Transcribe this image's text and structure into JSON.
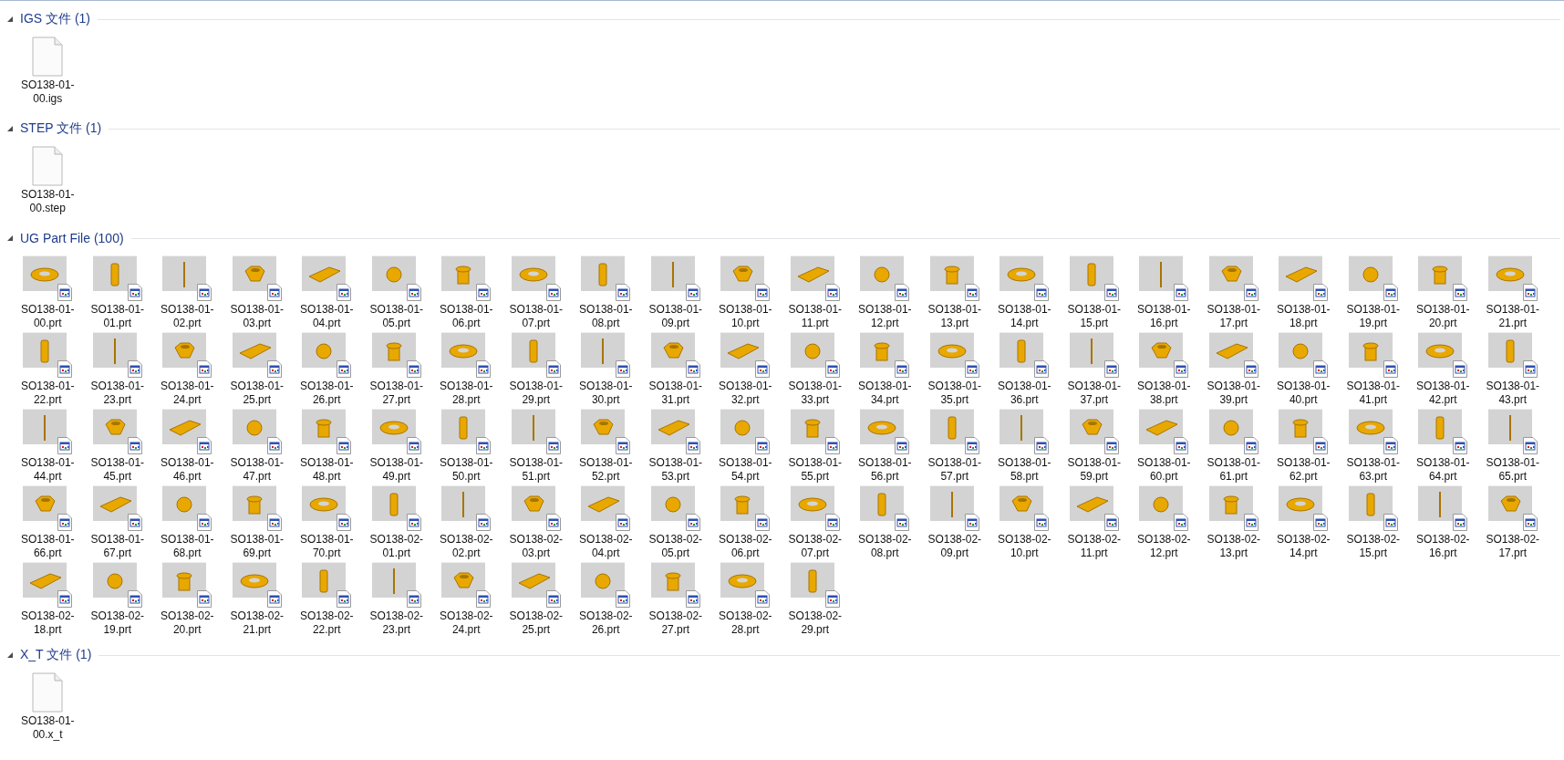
{
  "groups": [
    {
      "title": "IGS 文件 (1)",
      "expanded": true,
      "kind": "document",
      "files": [
        "SO138-01-00.igs"
      ]
    },
    {
      "title": "STEP 文件 (1)",
      "expanded": true,
      "kind": "document",
      "files": [
        "SO138-01-00.step"
      ]
    },
    {
      "title": "UG Part File (100)",
      "expanded": true,
      "kind": "part",
      "files": [
        "SO138-01-00.prt",
        "SO138-01-01.prt",
        "SO138-01-02.prt",
        "SO138-01-03.prt",
        "SO138-01-04.prt",
        "SO138-01-05.prt",
        "SO138-01-06.prt",
        "SO138-01-07.prt",
        "SO138-01-08.prt",
        "SO138-01-09.prt",
        "SO138-01-10.prt",
        "SO138-01-11.prt",
        "SO138-01-12.prt",
        "SO138-01-13.prt",
        "SO138-01-14.prt",
        "SO138-01-15.prt",
        "SO138-01-16.prt",
        "SO138-01-17.prt",
        "SO138-01-18.prt",
        "SO138-01-19.prt",
        "SO138-01-20.prt",
        "SO138-01-21.prt",
        "SO138-01-22.prt",
        "SO138-01-23.prt",
        "SO138-01-24.prt",
        "SO138-01-25.prt",
        "SO138-01-26.prt",
        "SO138-01-27.prt",
        "SO138-01-28.prt",
        "SO138-01-29.prt",
        "SO138-01-30.prt",
        "SO138-01-31.prt",
        "SO138-01-32.prt",
        "SO138-01-33.prt",
        "SO138-01-34.prt",
        "SO138-01-35.prt",
        "SO138-01-36.prt",
        "SO138-01-37.prt",
        "SO138-01-38.prt",
        "SO138-01-39.prt",
        "SO138-01-40.prt",
        "SO138-01-41.prt",
        "SO138-01-42.prt",
        "SO138-01-43.prt",
        "SO138-01-44.prt",
        "SO138-01-45.prt",
        "SO138-01-46.prt",
        "SO138-01-47.prt",
        "SO138-01-48.prt",
        "SO138-01-49.prt",
        "SO138-01-50.prt",
        "SO138-01-51.prt",
        "SO138-01-52.prt",
        "SO138-01-53.prt",
        "SO138-01-54.prt",
        "SO138-01-55.prt",
        "SO138-01-56.prt",
        "SO138-01-57.prt",
        "SO138-01-58.prt",
        "SO138-01-59.prt",
        "SO138-01-60.prt",
        "SO138-01-61.prt",
        "SO138-01-62.prt",
        "SO138-01-63.prt",
        "SO138-01-64.prt",
        "SO138-01-65.prt",
        "SO138-01-66.prt",
        "SO138-01-67.prt",
        "SO138-01-68.prt",
        "SO138-01-69.prt",
        "SO138-01-70.prt",
        "SO138-02-01.prt",
        "SO138-02-02.prt",
        "SO138-02-03.prt",
        "SO138-02-04.prt",
        "SO138-02-05.prt",
        "SO138-02-06.prt",
        "SO138-02-07.prt",
        "SO138-02-08.prt",
        "SO138-02-09.prt",
        "SO138-02-10.prt",
        "SO138-02-11.prt",
        "SO138-02-12.prt",
        "SO138-02-13.prt",
        "SO138-02-14.prt",
        "SO138-02-15.prt",
        "SO138-02-16.prt",
        "SO138-02-17.prt",
        "SO138-02-18.prt",
        "SO138-02-19.prt",
        "SO138-02-20.prt",
        "SO138-02-21.prt",
        "SO138-02-22.prt",
        "SO138-02-23.prt",
        "SO138-02-24.prt",
        "SO138-02-25.prt",
        "SO138-02-26.prt",
        "SO138-02-27.prt",
        "SO138-02-28.prt",
        "SO138-02-29.prt"
      ]
    },
    {
      "title": "X_T 文件 (1)",
      "expanded": true,
      "kind": "document",
      "files": [
        "SO138-01-00.x_t"
      ]
    }
  ]
}
